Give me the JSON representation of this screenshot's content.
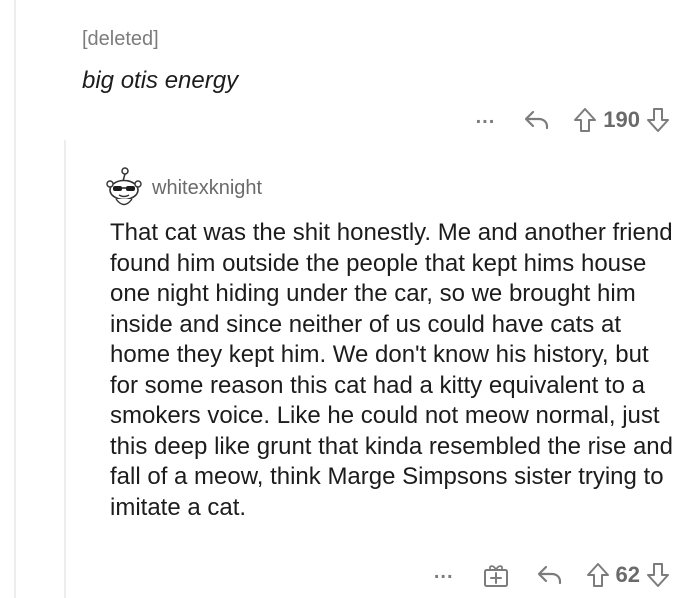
{
  "parent_comment": {
    "author": "[deleted]",
    "body": "big otis energy",
    "more_label": "...",
    "score": "190"
  },
  "child_comment": {
    "author": "whitexknight",
    "body": "That cat was the shit honestly. Me and another friend found him outside the people that kept hims house one night hiding under the car, so we brought him inside and since neither of us could have cats at home they kept him. We don't know his history, but for some reason this cat had a kitty equivalent to a smokers voice. Like he could not meow normal, just this deep like grunt that kinda resembled the rise and fall of a meow, think Marge Simpsons sister trying to imitate a cat.",
    "more_label": "...",
    "score": "62"
  },
  "icons": {
    "reply": "reply-arrow-icon",
    "upvote": "upvote-arrow-icon",
    "downvote": "downvote-arrow-icon",
    "award": "gift-award-icon",
    "avatar": "snoo-avatar-icon"
  },
  "colors": {
    "meta_text": "#7c7c7c",
    "body_text": "#1c1c1c",
    "thread_line": "#ededed"
  }
}
